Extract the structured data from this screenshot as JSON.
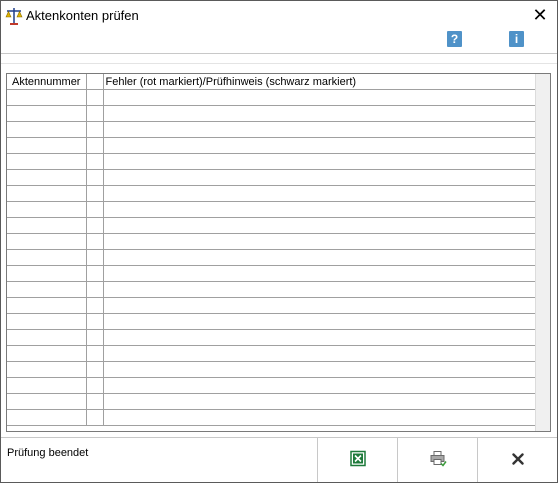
{
  "window": {
    "title": "Aktenkonten prüfen"
  },
  "toolbar": {
    "help_symbol": "?",
    "info_symbol": "i"
  },
  "table": {
    "columns": [
      {
        "label": "Aktennummer"
      },
      {
        "label": ""
      },
      {
        "label": "Fehler (rot markiert)/Prüfhinweis (schwarz markiert)"
      }
    ],
    "rows": 21
  },
  "status": {
    "text": "Prüfung beendet"
  },
  "icons": {
    "app": "scales-justice-icon",
    "close": "close-icon",
    "help": "help-icon",
    "info": "info-icon",
    "excel": "excel-export-icon",
    "print": "printer-icon",
    "cancel": "cancel-icon"
  },
  "colors": {
    "accent": "#4f92c8",
    "excel_green": "#1d7a3a"
  }
}
